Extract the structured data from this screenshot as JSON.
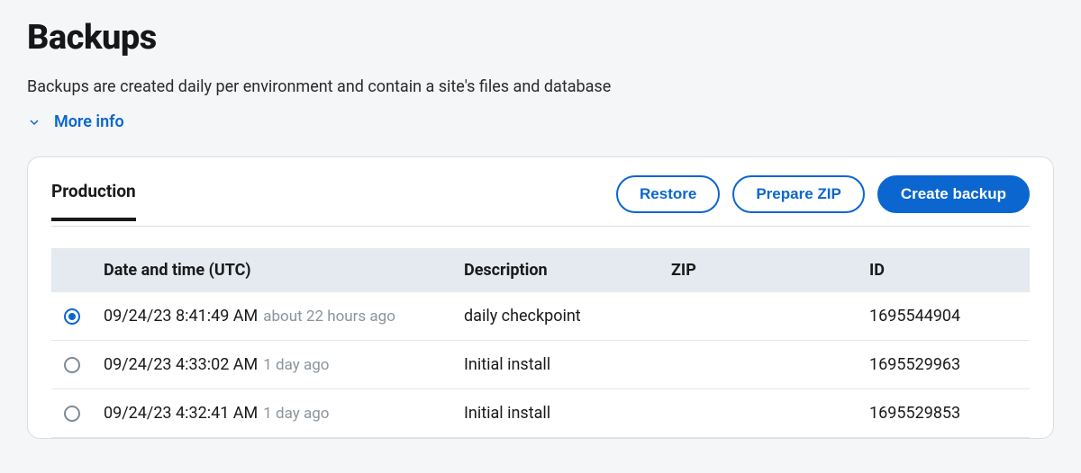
{
  "page": {
    "title": "Backups",
    "subtitle": "Backups are created daily per environment and contain a site's files and database",
    "more_info_label": "More info"
  },
  "tabs": [
    {
      "label": "Production"
    }
  ],
  "actions": {
    "restore": "Restore",
    "prepare_zip": "Prepare ZIP",
    "create_backup": "Create backup"
  },
  "table": {
    "headers": {
      "date": "Date and time (UTC)",
      "description": "Description",
      "zip": "ZIP",
      "id": "ID"
    },
    "rows": [
      {
        "selected": true,
        "datetime": "09/24/23 8:41:49 AM",
        "relative": "about 22 hours ago",
        "description": "daily checkpoint",
        "zip": "",
        "id": "1695544904"
      },
      {
        "selected": false,
        "datetime": "09/24/23 4:33:02 AM",
        "relative": "1 day ago",
        "description": "Initial install",
        "zip": "",
        "id": "1695529963"
      },
      {
        "selected": false,
        "datetime": "09/24/23 4:32:41 AM",
        "relative": "1 day ago",
        "description": "Initial install",
        "zip": "",
        "id": "1695529853"
      }
    ]
  }
}
